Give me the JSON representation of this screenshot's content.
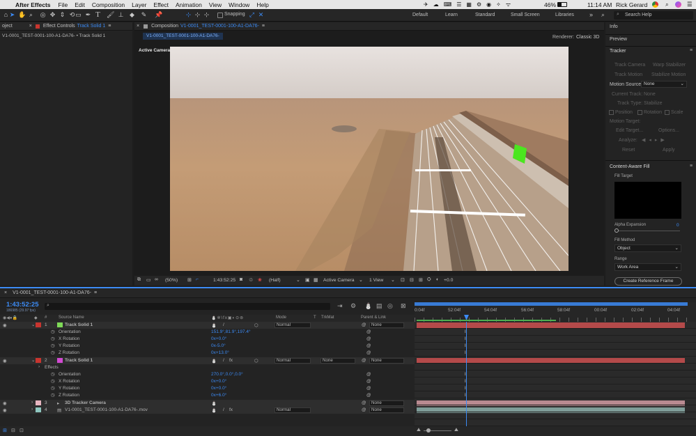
{
  "menubar": {
    "app_name": "After Effects",
    "items": [
      "File",
      "Edit",
      "Composition",
      "Layer",
      "Effect",
      "Animation",
      "View",
      "Window",
      "Help"
    ],
    "battery": "46%",
    "clock": "11:14 AM",
    "user": "Rick Gerard"
  },
  "toolbar": {
    "snapping_label": "Snapping",
    "workspaces": [
      "Default",
      "Learn",
      "Standard",
      "Small Screen",
      "Libraries"
    ],
    "search_placeholder": "Search Help"
  },
  "left_panel": {
    "tab_partial": "oject",
    "effect_controls_label": "Effect Controls",
    "effect_controls_layer": "Track Solid 1",
    "breadcrumb": "V1-0001_TEST-0001-100-A1-DA76- • Track Solid 1"
  },
  "comp_panel": {
    "tab_prefix": "Composition",
    "tab_name": "V1-0001_TEST-0001-100-A1-DA76-",
    "comp_button": "V1-0001_TEST-0001-100-A1-DA76-",
    "renderer_label": "Renderer:",
    "renderer_value": "Classic 3D",
    "view_label": "Active Camera",
    "footer": {
      "zoom": "(50%)",
      "timecode": "1:43:52:25",
      "resolution": "(Half)",
      "camera": "Active Camera",
      "views": "1 View",
      "exposure": "+0.0"
    }
  },
  "right_panel": {
    "info": "Info",
    "preview": "Preview",
    "tracker": {
      "title": "Tracker",
      "track_camera": "Track Camera",
      "warp_stabilizer": "Warp Stabilizer",
      "track_motion": "Track Motion",
      "stabilize_motion": "Stabilize Motion",
      "motion_source_label": "Motion Source:",
      "motion_source_value": "None",
      "current_track_label": "Current Track:",
      "current_track_value": "None",
      "track_type_label": "Track Type:",
      "track_type_value": "Stabilize",
      "position": "Position",
      "rotation": "Rotation",
      "scale": "Scale",
      "motion_target": "Motion Target:",
      "edit_target": "Edit Target...",
      "options": "Options...",
      "analyze": "Analyze:",
      "reset": "Reset",
      "apply": "Apply"
    },
    "caf": {
      "title": "Content-Aware Fill",
      "fill_target": "Fill Target",
      "alpha_expansion": "Alpha Expansion",
      "alpha_value": "0",
      "fill_method": "Fill Method",
      "fill_method_value": "Object",
      "range": "Range",
      "range_value": "Work Area",
      "create_ref": "Create Reference Frame"
    }
  },
  "timeline": {
    "tab_name": "V1-0001_TEST-0001-100-A1-DA76-",
    "timecode": "1:43:52:25",
    "frames": "186985 (29.97 fps)",
    "headers": {
      "num": "#",
      "source": "Source Name",
      "mode": "Mode",
      "t": "T",
      "trkmat": "TrkMat",
      "parent": "Parent & Link"
    },
    "ruler": [
      "0:04f",
      "52:04f",
      "54:04f",
      "56:04f",
      "58:04f",
      "00:04f",
      "02:04f",
      "04:04f"
    ],
    "rows": [
      {
        "kind": "layer",
        "num": "1",
        "name": "Track Solid 1",
        "mode": "Normal",
        "parent": "None",
        "color": "#7ed957"
      },
      {
        "kind": "prop",
        "name": "Orientation",
        "value": "151.9°,81.9°,197.4°"
      },
      {
        "kind": "prop",
        "name": "X Rotation",
        "value": "0x+0.0°"
      },
      {
        "kind": "prop",
        "name": "Y Rotation",
        "value": "0x-5.0°"
      },
      {
        "kind": "prop",
        "name": "Z Rotation",
        "value": "0x+13.0°"
      },
      {
        "kind": "layer",
        "num": "2",
        "name": "Track Solid 1",
        "mode": "Normal",
        "trkmat": "None",
        "parent": "None",
        "color": "#d24ad2"
      },
      {
        "kind": "group",
        "name": "Effects"
      },
      {
        "kind": "prop",
        "name": "Orientation",
        "value": "270.0°,0.0°,0.0°"
      },
      {
        "kind": "prop",
        "name": "X Rotation",
        "value": "0x+0.0°"
      },
      {
        "kind": "prop",
        "name": "Y Rotation",
        "value": "0x+0.0°"
      },
      {
        "kind": "prop",
        "name": "Z Rotation",
        "value": "0x+6.0°"
      },
      {
        "kind": "layer",
        "num": "3",
        "name": "3D Tracker Camera",
        "parent": "None",
        "color": "#e7b5c0"
      },
      {
        "kind": "layer",
        "num": "4",
        "name": "V1-0001_TEST-0001-100-A1-DA76-.mov",
        "mode": "Normal",
        "parent": "None",
        "color": "#8fc7c0"
      }
    ]
  },
  "colors": {
    "accent": "#3c8bf5",
    "solid_bar": "#b44a4a",
    "camera_bar": "#b98a91",
    "footage_bar": "#7f9c98"
  }
}
